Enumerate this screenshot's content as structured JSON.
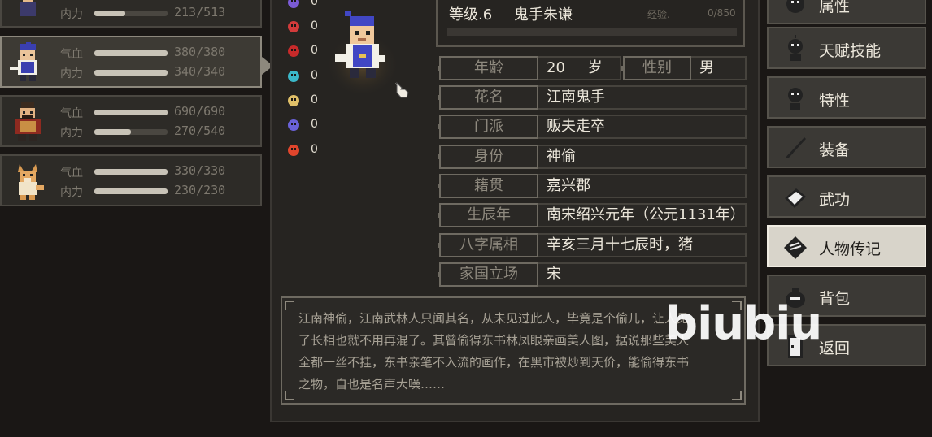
{
  "party": [
    {
      "hp_label": "",
      "hp_value": "",
      "mp_label": "内力",
      "mp_value": "213/513",
      "hp_frac": 0.0,
      "mp_frac": 0.42,
      "selected": false
    },
    {
      "hp_label": "气血",
      "hp_value": "380/380",
      "mp_label": "内力",
      "mp_value": "340/340",
      "hp_frac": 1.0,
      "mp_frac": 1.0,
      "selected": true
    },
    {
      "hp_label": "气血",
      "hp_value": "690/690",
      "mp_label": "内力",
      "mp_value": "270/540",
      "hp_frac": 1.0,
      "mp_frac": 0.5,
      "selected": false
    },
    {
      "hp_label": "气血",
      "hp_value": "330/330",
      "mp_label": "内力",
      "mp_value": "230/230",
      "hp_frac": 1.0,
      "mp_frac": 1.0,
      "selected": false
    }
  ],
  "status_effects": [
    {
      "icon": "purple-skull-icon",
      "count": "0",
      "color": "#7b5bd6"
    },
    {
      "icon": "broken-heart-icon",
      "count": "0",
      "color": "#d23b3b"
    },
    {
      "icon": "red-poison-icon",
      "count": "0",
      "color": "#c72a2a"
    },
    {
      "icon": "cyan-spirit-icon",
      "count": "0",
      "color": "#3bb8c9"
    },
    {
      "icon": "dizzy-star-icon",
      "count": "0",
      "color": "#e0c068"
    },
    {
      "icon": "blue-mask-icon",
      "count": "0",
      "color": "#6a62d9"
    },
    {
      "icon": "fire-icon",
      "count": "0",
      "color": "#e0452c"
    }
  ],
  "header": {
    "level": "等级.6",
    "name": "鬼手朱谦",
    "exp_label": "经验.",
    "exp_value": "0/850"
  },
  "profile": {
    "age_label": "年龄",
    "age_value": "20",
    "age_unit": "岁",
    "gender_label": "性别",
    "gender_value": "男",
    "rows": [
      {
        "label": "花名",
        "value": "江南鬼手"
      },
      {
        "label": "门派",
        "value": "贩夫走卒"
      },
      {
        "label": "身份",
        "value": "神偷"
      },
      {
        "label": "籍贯",
        "value": "嘉兴郡"
      },
      {
        "label": "生辰年",
        "value": "南宋绍兴元年（公元1131年）"
      },
      {
        "label": "八字属相",
        "value": "辛亥三月十七辰时，猪"
      },
      {
        "label": "家国立场",
        "value": "宋"
      }
    ]
  },
  "biography": {
    "line1": "江南神偷，江南武林人只闻其名，从未见过此人，毕竟是个偷儿，让人见",
    "line2": "了长相也就不用再混了。其曾偷得东书林凤眼亲画美人图，据说那些美人",
    "line3": "全都一丝不挂，东书亲笔不入流的画作，在黑市被炒到天价，能偷得东书",
    "line4": "之物，自也是名声大噪……"
  },
  "menu": [
    {
      "label": "属性",
      "icon": "attributes-icon",
      "active": false
    },
    {
      "label": "天赋技能",
      "icon": "talent-skill-icon",
      "active": false
    },
    {
      "label": "特性",
      "icon": "trait-icon",
      "active": false
    },
    {
      "label": "装备",
      "icon": "sword-icon",
      "active": false
    },
    {
      "label": "武功",
      "icon": "martial-book-icon",
      "active": false
    },
    {
      "label": "人物传记",
      "icon": "biography-scroll-icon",
      "active": true
    },
    {
      "label": "背包",
      "icon": "bag-icon",
      "active": false
    },
    {
      "label": "返回",
      "icon": "return-door-icon",
      "active": false
    }
  ],
  "watermark": "biubiu",
  "colors": {
    "accent_active": "#d8d4ca",
    "panel": "#262421",
    "text": "#ebe6da"
  }
}
